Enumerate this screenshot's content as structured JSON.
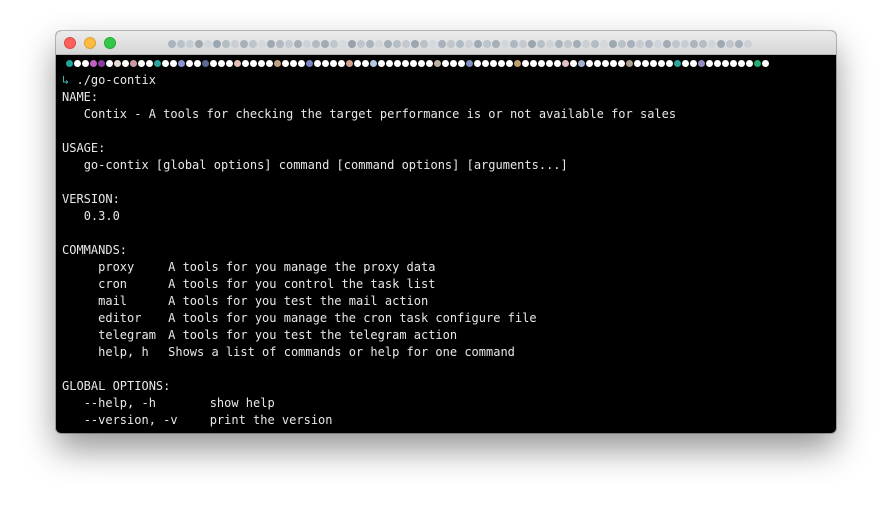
{
  "window": {
    "title_blur_colors": [
      "#aab4be",
      "#b8c2cc",
      "#c6cdd4",
      "#a0a8b0",
      "#d0d6dc",
      "#9aa6b2",
      "#b4bcc4",
      "#c8ced4",
      "#a8b0ba",
      "#bcc4cc",
      "#d2d8dd",
      "#9ea8b2",
      "#b0b8c0",
      "#c4cad0",
      "#a6aeb8",
      "#ccd2d8",
      "#b2bac2",
      "#a2acb6",
      "#c0c8ce",
      "#d6dbe0",
      "#98a2ac",
      "#bec6cc",
      "#aab2bc",
      "#cfd5da",
      "#a4aeb8",
      "#b6bec6",
      "#c2c8ce",
      "#9ca6b0",
      "#b8c0c8",
      "#d4d9de",
      "#a8b2bc",
      "#c0c6cc",
      "#b0bac4",
      "#cad0d6",
      "#9fa9b3",
      "#bbc3cb",
      "#a5afb9",
      "#d1d7dc",
      "#adb5bf",
      "#c3c9cf",
      "#9ba5af",
      "#b7bfc7",
      "#cdd3d8",
      "#a9b3bd",
      "#bfc5cb",
      "#a3adb7",
      "#c9cfd4",
      "#b3bbc3",
      "#d3d8dd",
      "#9da7b1",
      "#b9c1c9",
      "#a7b1bb",
      "#c5cbd1",
      "#aeb6c0",
      "#ced4d9",
      "#a1abb5",
      "#bdc5cd",
      "#c7cdd3",
      "#abb3bd",
      "#b5bdc5",
      "#d0d5da",
      "#9fa9b3",
      "#c1c7cd",
      "#a6b0ba",
      "#cbd1d6"
    ]
  },
  "terminal": {
    "prompt_blur_colors": [
      "#1fa69a",
      "#ffffff",
      "#ffffff",
      "#c060c0",
      "#8a3da0",
      "#ffffff",
      "#e8d8d0",
      "#ffffff",
      "#c99ba0",
      "#ffffff",
      "#ffffff",
      "#2aa89c",
      "#ffffff",
      "#ffffff",
      "#8a96d0",
      "#ffffff",
      "#ffffff",
      "#5a6a90",
      "#ffffff",
      "#ffffff",
      "#ffffff",
      "#e0c0b0",
      "#ffffff",
      "#ffffff",
      "#ffffff",
      "#ffffff",
      "#c0a080",
      "#ffffff",
      "#ffffff",
      "#ffffff",
      "#7a86c0",
      "#ffffff",
      "#ffffff",
      "#ffffff",
      "#ffffff",
      "#d0a090",
      "#ffffff",
      "#ffffff",
      "#b0c8e0",
      "#ffffff",
      "#ffffff",
      "#ffffff",
      "#ffffff",
      "#ffffff",
      "#ffffff",
      "#ffffff",
      "#c0b0a0",
      "#ffffff",
      "#ffffff",
      "#ffffff",
      "#8090c0",
      "#ffffff",
      "#ffffff",
      "#ffffff",
      "#ffffff",
      "#ffffff",
      "#c0a070",
      "#ffffff",
      "#ffffff",
      "#ffffff",
      "#ffffff",
      "#ffffff",
      "#e0c0c0",
      "#ffffff",
      "#a0b0d0",
      "#ffffff",
      "#ffffff",
      "#ffffff",
      "#ffffff",
      "#ffffff",
      "#b0a090",
      "#ffffff",
      "#ffffff",
      "#ffffff",
      "#ffffff",
      "#ffffff",
      "#2aa89c",
      "#ffffff",
      "#ffffff",
      "#9090c0",
      "#ffffff",
      "#ffffff",
      "#ffffff",
      "#ffffff",
      "#ffffff",
      "#ffffff",
      "#22b070",
      "#ffffff"
    ],
    "prompt_arrow": "↳",
    "command": "./go-contix",
    "name_header": "NAME:",
    "name_value": "Contix - A tools for checking the target performance is or not available for sales",
    "usage_header": "USAGE:",
    "usage_value": "go-contix [global options] command [command options] [arguments...]",
    "version_header": "VERSION:",
    "version_value": "0.3.0",
    "commands_header": "COMMANDS:",
    "commands": [
      {
        "name": "proxy",
        "desc": "A tools for you manage the proxy data"
      },
      {
        "name": "cron",
        "desc": "A tools for you control the task list"
      },
      {
        "name": "mail",
        "desc": "A tools for you test the mail action"
      },
      {
        "name": "editor",
        "desc": "A tools for you manage the cron task configure file"
      },
      {
        "name": "telegram",
        "desc": "A tools for you test the telegram action"
      },
      {
        "name": "help, h",
        "desc": "Shows a list of commands or help for one command"
      }
    ],
    "options_header": "GLOBAL OPTIONS:",
    "options": [
      {
        "name": "--help, -h",
        "desc": "show help"
      },
      {
        "name": "--version, -v",
        "desc": "print the version"
      }
    ]
  }
}
